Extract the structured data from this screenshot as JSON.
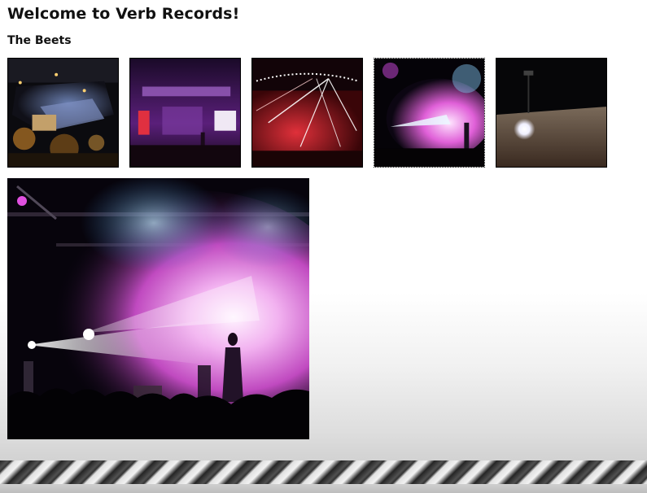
{
  "page": {
    "title": "Welcome to Verb Records!",
    "subtitle": "The Beets"
  },
  "gallery": {
    "thumbnails": [
      {
        "alt": "aerial stadium concert at night"
      },
      {
        "alt": "purple stage with screens"
      },
      {
        "alt": "red stage with laser beams"
      },
      {
        "alt": "singer under pink and blue spotlights"
      },
      {
        "alt": "bright stadium light over crowd"
      }
    ],
    "selected_index": 3
  }
}
